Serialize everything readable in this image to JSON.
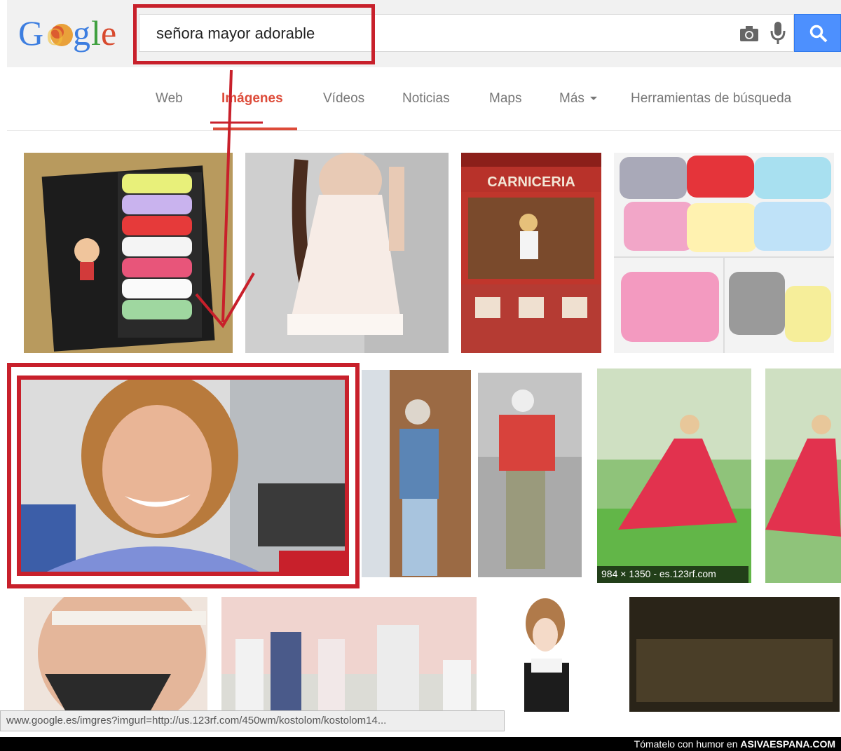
{
  "search": {
    "query": "señora mayor adorable"
  },
  "tabs": [
    {
      "label": "Web"
    },
    {
      "label": "Imágenes",
      "active": true
    },
    {
      "label": "Vídeos"
    },
    {
      "label": "Noticias"
    },
    {
      "label": "Maps"
    },
    {
      "label": "Más"
    },
    {
      "label": "Herramientas de búsqueda"
    }
  ],
  "results": {
    "carniceria_sign": "CARNICERIA",
    "size_label": "984 × 1350 - es.123rf.com"
  },
  "statusbar": {
    "url": "www.google.es/imgres?imgurl=http://us.123rf.com/450wm/kostolom/kostolom14..."
  },
  "watermark": {
    "prefix": "Tómatelo con humor en",
    "site": "ASIVAESPANA.COM"
  },
  "colors": {
    "accent_red": "#c8202b",
    "google_blue": "#4d90fe",
    "active_tab": "#dd4b39"
  }
}
